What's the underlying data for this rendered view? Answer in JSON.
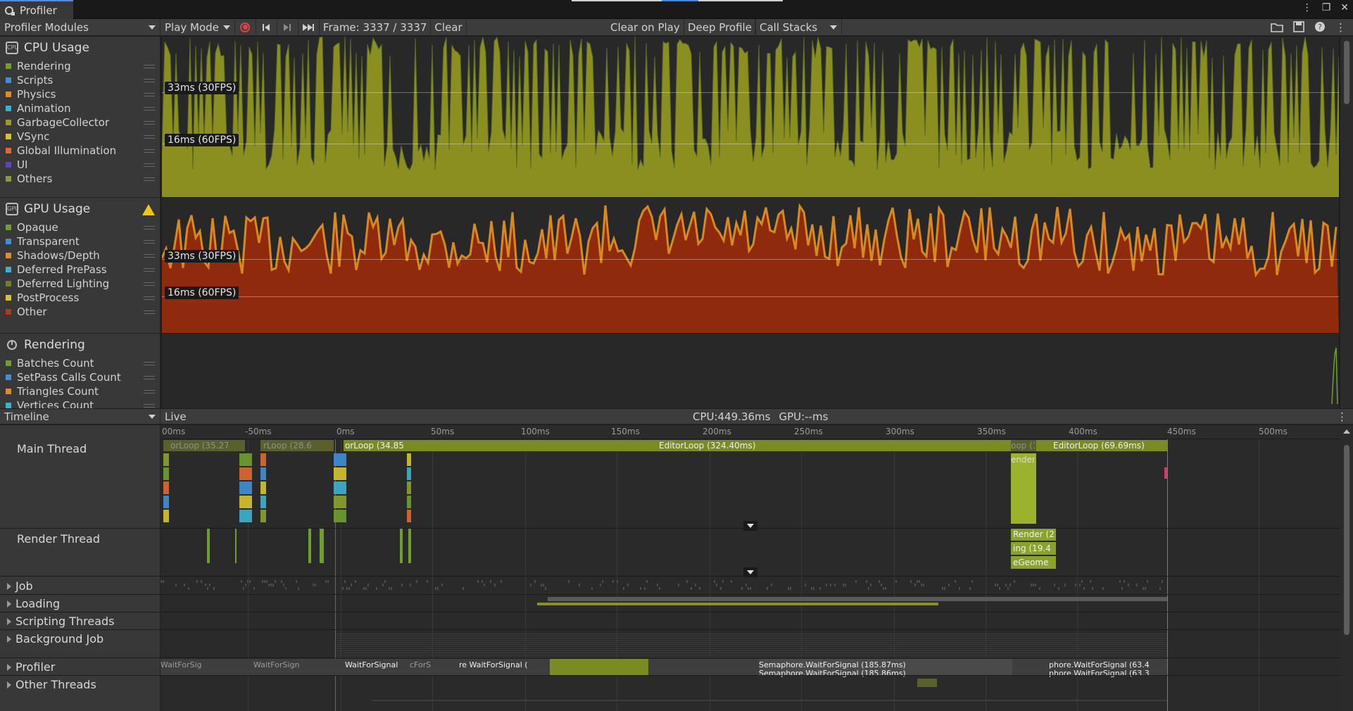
{
  "window": {
    "tab_title": "Profiler",
    "icons": [
      "more-icon",
      "maximize-icon",
      "close-icon"
    ]
  },
  "toolbar": {
    "modules_label": "Profiler Modules",
    "play_mode_label": "Play Mode",
    "frame_label": "Frame: 3337 / 3337",
    "clear_label": "Clear",
    "clear_on_play_label": "Clear on Play",
    "deep_profile_label": "Deep Profile",
    "call_stacks_label": "Call Stacks"
  },
  "modules": {
    "cpu": {
      "title": "CPU Usage",
      "items": [
        {
          "label": "Rendering",
          "color": "#6ea02e"
        },
        {
          "label": "Scripts",
          "color": "#3f8fd8"
        },
        {
          "label": "Physics",
          "color": "#e28a29"
        },
        {
          "label": "Animation",
          "color": "#3fb1d0"
        },
        {
          "label": "GarbageCollector",
          "color": "#9a9a2a"
        },
        {
          "label": "VSync",
          "color": "#d6c42c"
        },
        {
          "label": "Global Illumination",
          "color": "#e0692d"
        },
        {
          "label": "UI",
          "color": "#6245b5"
        },
        {
          "label": "Others",
          "color": "#8a9c3a"
        }
      ],
      "fps_lines": [
        "33ms (30FPS)",
        "16ms (60FPS)"
      ]
    },
    "gpu": {
      "title": "GPU Usage",
      "items": [
        {
          "label": "Opaque",
          "color": "#6ea02e"
        },
        {
          "label": "Transparent",
          "color": "#3f8fd8"
        },
        {
          "label": "Shadows/Depth",
          "color": "#e28a29"
        },
        {
          "label": "Deferred PrePass",
          "color": "#3fb1d0"
        },
        {
          "label": "Deferred Lighting",
          "color": "#6e7f2a"
        },
        {
          "label": "PostProcess",
          "color": "#d6c42c"
        },
        {
          "label": "Other",
          "color": "#b0391a"
        }
      ],
      "fps_lines": [
        "33ms (30FPS)",
        "16ms (60FPS)"
      ]
    },
    "rendering": {
      "title": "Rendering",
      "items": [
        {
          "label": "Batches Count",
          "color": "#6ea02e"
        },
        {
          "label": "SetPass Calls Count",
          "color": "#3f8fd8"
        },
        {
          "label": "Triangles Count",
          "color": "#e28a29"
        },
        {
          "label": "Vertices Count",
          "color": "#3fb1d0"
        }
      ]
    }
  },
  "timeline": {
    "view_label": "Timeline",
    "live_label": "Live",
    "cpu_stat": "CPU:449.36ms",
    "gpu_stat": "GPU:--ms",
    "ruler_ticks": [
      "00ms",
      "-50ms",
      "0ms",
      "50ms",
      "100ms",
      "150ms",
      "200ms",
      "250ms",
      "300ms",
      "350ms",
      "400ms",
      "450ms",
      "500ms"
    ],
    "threads": {
      "main": "Main Thread",
      "render": "Render Thread",
      "job": "Job",
      "loading": "Loading",
      "scripting": "Scripting Threads",
      "background": "Background Job",
      "profiler": "Profiler",
      "other": "Other Threads"
    },
    "main_bars": [
      "orLoop (35.27",
      "rLoop (28.6",
      "orLoop (34.85",
      "EditorLoop (324.40ms)",
      "oop (1",
      "EditorLoop (69.69ms)",
      "ender"
    ],
    "render_bars": [
      "Render (2",
      "ing (19.4",
      "eGeome"
    ],
    "profiler_bars": [
      "WaitForSig",
      "WaitForSign",
      "WaitForSignal",
      "cForS",
      "re WaitForSignal (",
      "Semaphore.WaitForSignal (185.87ms)",
      "phore.WaitForSignal (63.4",
      "Semaphore.WaitForSignal (185.86ms)",
      "phore.WaitForSignal (63.3"
    ]
  }
}
